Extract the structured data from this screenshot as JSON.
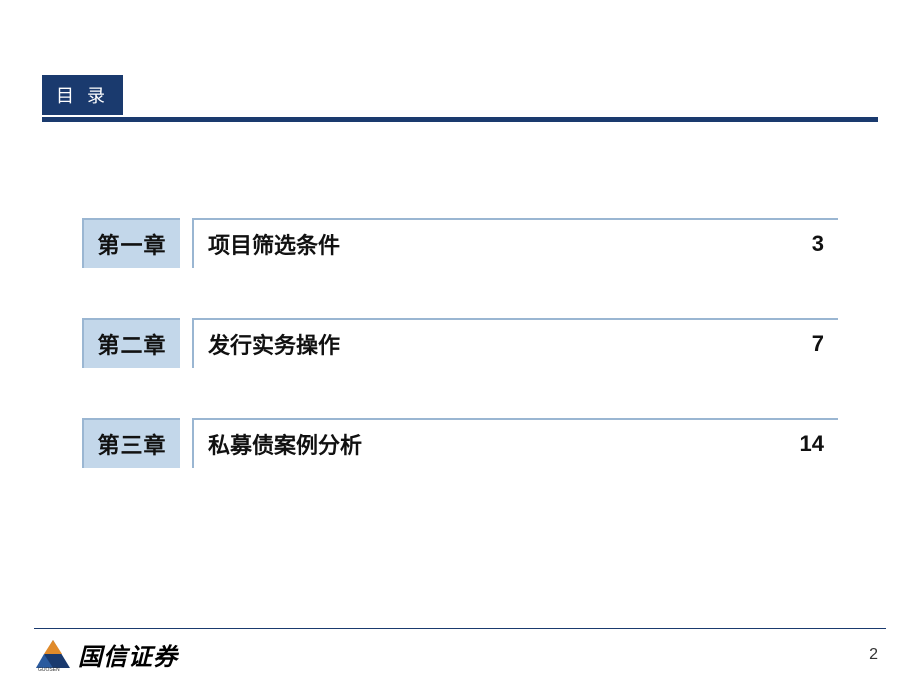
{
  "header": {
    "title": "目 录"
  },
  "toc": [
    {
      "chapter": "第一章",
      "title": "项目筛选条件",
      "page": "3"
    },
    {
      "chapter": "第二章",
      "title": "发行实务操作",
      "page": "7"
    },
    {
      "chapter": "第三章",
      "title": "私募债案例分析",
      "page": "14"
    }
  ],
  "footer": {
    "company": "国信证券",
    "company_sub": "GUOSEN",
    "slide_number": "2"
  },
  "colors": {
    "brand_navy": "#1a3a6e",
    "badge_bg": "#c3d7ea",
    "badge_border": "#9ab6d2"
  }
}
